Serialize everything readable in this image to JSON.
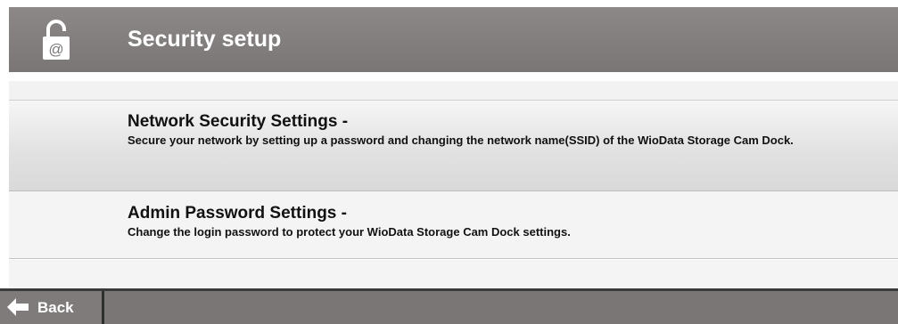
{
  "header": {
    "title": "Security setup",
    "icon": "lock-open-at-icon",
    "icon_glyph": "@"
  },
  "menu": {
    "items": [
      {
        "title": "Network Security Settings -",
        "description": "Secure your network by setting up a password and changing the network name(SSID) of the WioData Storage Cam Dock."
      },
      {
        "title": "Admin Password Settings -",
        "description": "Change the login password to protect your WioData Storage Cam Dock settings."
      }
    ]
  },
  "footer": {
    "back_label": "Back",
    "back_icon": "arrow-left-icon"
  },
  "colors": {
    "header_bg": "#8c8888",
    "footer_bg": "#7a7676",
    "text_dark": "#111111",
    "text_light": "#ffffff"
  }
}
